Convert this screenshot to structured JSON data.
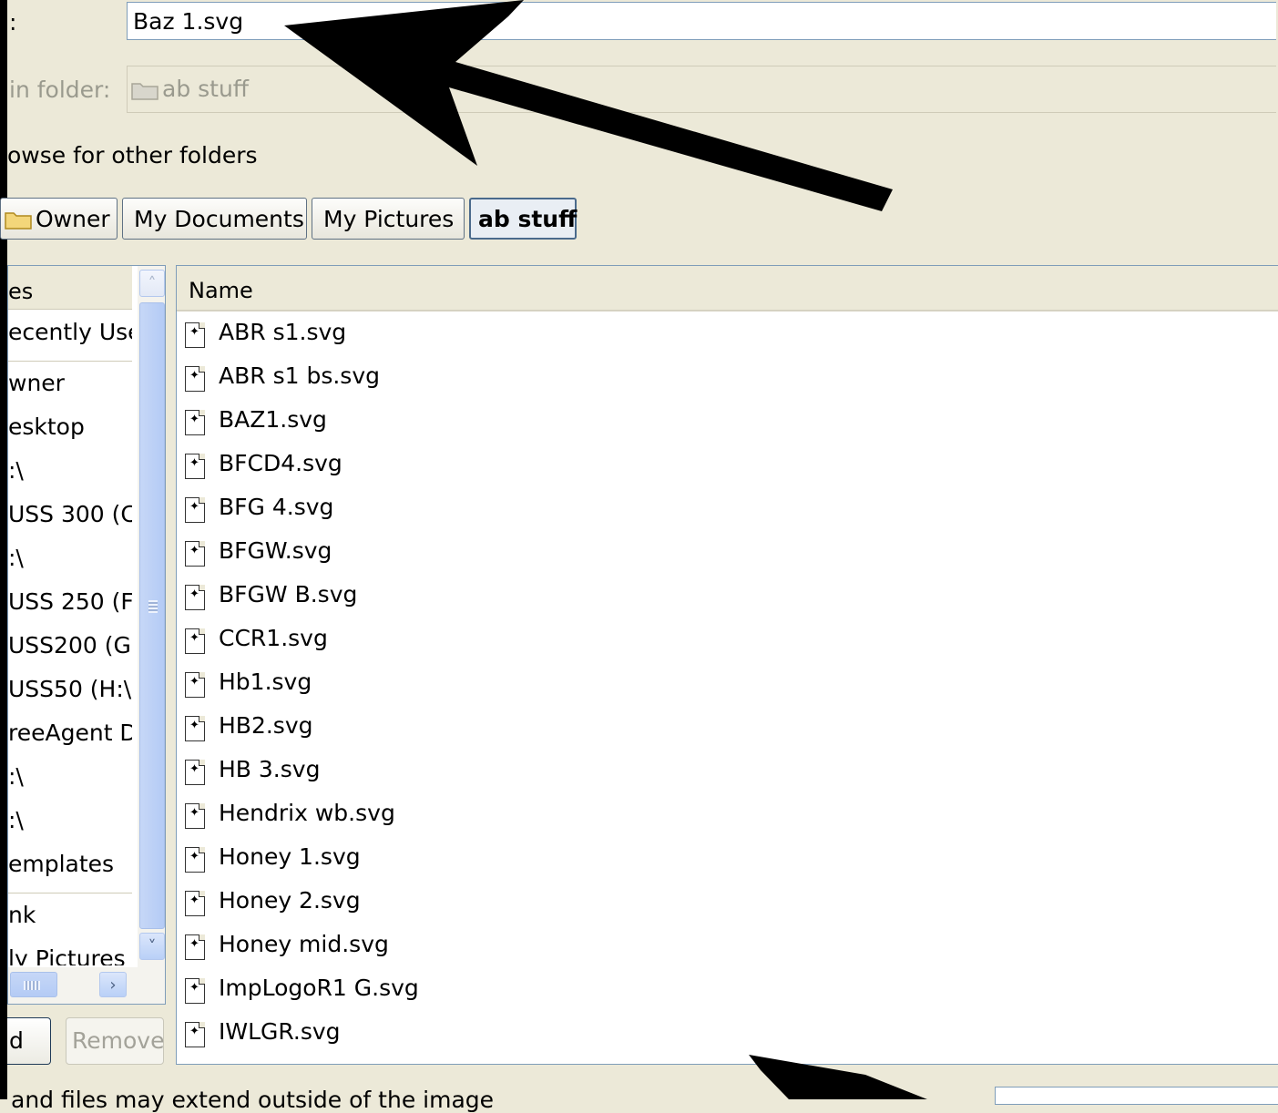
{
  "name_label": ":",
  "name_value": "Baz 1.svg",
  "save_in_label": "in folder:",
  "save_in_value": "ab stuff",
  "browse_label": "owse for other folders",
  "breadcrumbs": [
    "Owner",
    "My Documents",
    "My Pictures",
    "ab stuff"
  ],
  "places": {
    "header": "es",
    "items": [
      "ecently Use",
      "wner",
      "esktop",
      ":\\",
      "USS 300 (C",
      ":\\",
      "USS 250 (F",
      "USS200 (G",
      "USS50 (H:\\",
      "reeAgent Dr",
      ":\\",
      ":\\",
      "emplates",
      "nk",
      "ly Pictures"
    ]
  },
  "buttons": {
    "add": "d",
    "remove": "Remove"
  },
  "files": {
    "column_name": "Name",
    "items": [
      "ABR s1.svg",
      "ABR s1 bs.svg",
      "BAZ1.svg",
      "BFCD4.svg",
      "BFG 4.svg",
      "BFGW.svg",
      "BFGW B.svg",
      "CCR1.svg",
      "Hb1.svg",
      "HB2.svg",
      "HB 3.svg",
      "Hendrix wb.svg",
      "Honey 1.svg",
      "Honey 2.svg",
      "Honey mid.svg",
      "ImpLogoR1 G.svg",
      "IWLGR.svg"
    ]
  },
  "bottom_text": "and files may extend outside of the image",
  "icons": {
    "folder": "folder-icon",
    "file": "svg-file-icon",
    "scroll_up": "chevron-up-icon",
    "scroll_down": "chevron-down-icon",
    "scroll_right": "chevron-right-icon"
  },
  "colors": {
    "dialog_bg": "#ece9d8",
    "field_border": "#7f9db9",
    "annotation_arrow": "#000000"
  }
}
